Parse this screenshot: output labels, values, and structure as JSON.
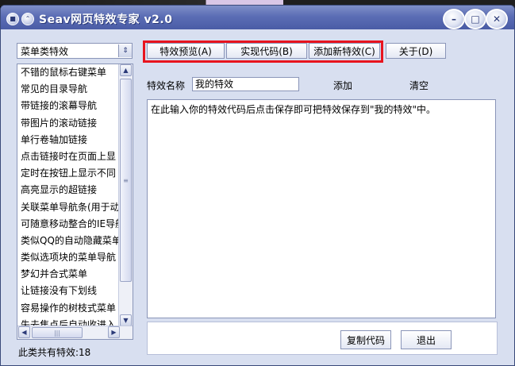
{
  "window": {
    "title": "Seav网页特效专家 v2.0"
  },
  "category_select": {
    "value": "菜单类特效"
  },
  "effect_list": [
    "不错的鼠标右键菜单",
    "常见的目录导航",
    "带链接的滚幕导航",
    "带图片的滚动链接",
    "单行卷轴加链接",
    "点击链接时在页面上显",
    "定时在按钮上显示不同",
    "高亮显示的超链接",
    "关联菜单导航条(用于动",
    "可随意移动整合的IE导航",
    "类似QQ的自动隐藏菜单",
    "类似选项块的菜单导航",
    "梦幻并合式菜单",
    "让链接没有下划线",
    "容易操作的树枝式菜单",
    "失去焦点后自动收进入"
  ],
  "count_label": "此类共有特效:18",
  "toolbar": {
    "preview": "特效预览(A)",
    "code": "实现代码(B)",
    "add_new": "添加新特效(C)",
    "about": "关于(D)"
  },
  "form": {
    "name_label": "特效名称",
    "name_value": "我的特效",
    "add_label": "添加",
    "clear_label": "清空",
    "code_hint": "在此输入你的特效代码后点击保存即可把特效保存到\"我的特效\"中。"
  },
  "bottom": {
    "copy_code": "复制代码",
    "exit": "退出"
  },
  "colors": {
    "highlight_border": "#e8141e",
    "titlebar": "#5b6db5",
    "window_bg": "#d8dff0"
  }
}
